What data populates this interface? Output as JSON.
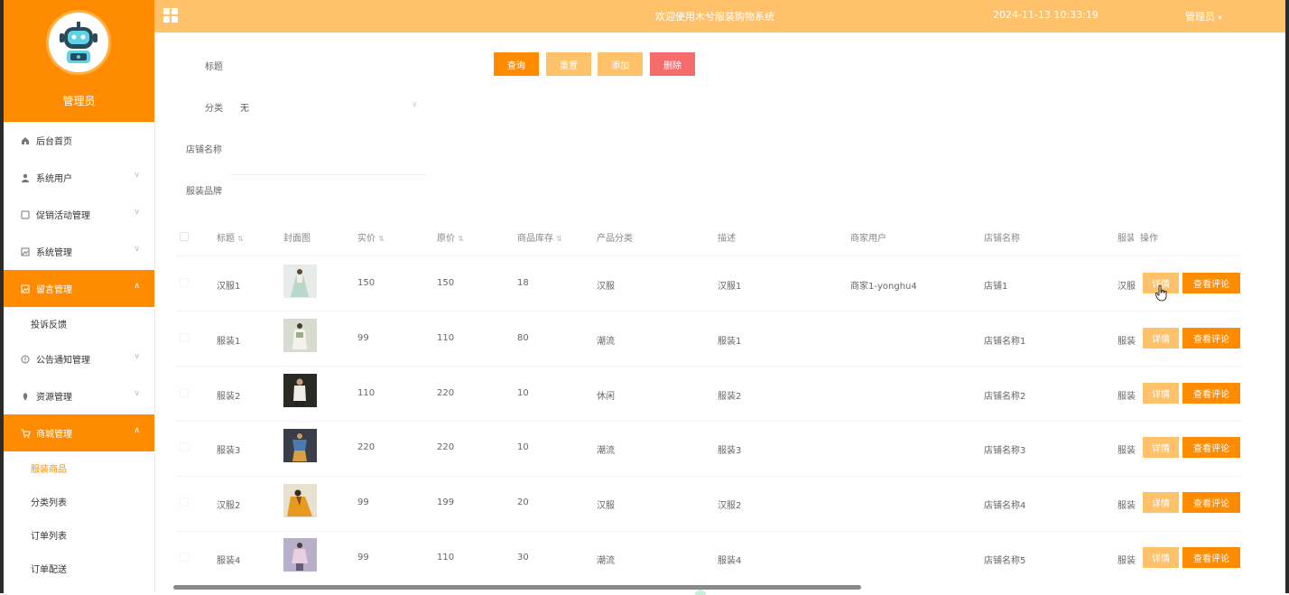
{
  "sidebar": {
    "role": "管理员",
    "menu": [
      {
        "label": "后台首页",
        "icon": "home-icon"
      },
      {
        "label": "系统用户",
        "icon": "user-icon"
      },
      {
        "label": "促销活动管理",
        "icon": "promotion-icon"
      },
      {
        "label": "系统管理",
        "icon": "image-icon"
      },
      {
        "label": "留言管理",
        "icon": "message-icon"
      },
      {
        "label": "投诉反馈"
      },
      {
        "label": "公告通知管理",
        "icon": "info-icon"
      },
      {
        "label": "资源管理",
        "icon": "location-icon"
      },
      {
        "label": "商城管理",
        "icon": "cart-icon"
      },
      {
        "label": "服装商品"
      },
      {
        "label": "分类列表"
      },
      {
        "label": "订单列表"
      },
      {
        "label": "订单配送"
      }
    ]
  },
  "topbar": {
    "title": "欢迎使用木兮服装购物系统",
    "datetime": "2024-11-13 10:33:19",
    "user": "管理员"
  },
  "search": {
    "title_label": "标题",
    "category_label": "分类",
    "category_value": "无",
    "store_label": "店铺名称",
    "brand_label": "服装品牌"
  },
  "actions": {
    "query": "查询",
    "reset": "重置",
    "add": "添加",
    "delete": "删除"
  },
  "table": {
    "columns": {
      "title": "标题",
      "cover": "封面图",
      "price": "实价",
      "original": "原价",
      "stock": "商品库存",
      "category": "产品分类",
      "desc": "描述",
      "merchant": "商家用户",
      "store": "店铺名称",
      "brand": "服装",
      "ops": "操作"
    },
    "detail_label": "详情",
    "comment_label": "查看评论",
    "rows": [
      {
        "title": "汉服1",
        "price": "150",
        "original": "150",
        "stock": "18",
        "category": "汉服",
        "desc": "汉服1",
        "merchant": "商家1-yonghu4",
        "store": "店铺1",
        "brand": "汉服"
      },
      {
        "title": "服装1",
        "price": "99",
        "original": "110",
        "stock": "80",
        "category": "潮流",
        "desc": "服装1",
        "merchant": "",
        "store": "店铺名称1",
        "brand": "服装"
      },
      {
        "title": "服装2",
        "price": "110",
        "original": "220",
        "stock": "10",
        "category": "休闲",
        "desc": "服装2",
        "merchant": "",
        "store": "店铺名称2",
        "brand": "服装"
      },
      {
        "title": "服装3",
        "price": "220",
        "original": "220",
        "stock": "10",
        "category": "潮流",
        "desc": "服装3",
        "merchant": "",
        "store": "店铺名称3",
        "brand": "服装"
      },
      {
        "title": "汉服2",
        "price": "99",
        "original": "199",
        "stock": "20",
        "category": "汉服",
        "desc": "汉服2",
        "merchant": "",
        "store": "店铺名称4",
        "brand": "服装"
      },
      {
        "title": "服装4",
        "price": "99",
        "original": "110",
        "stock": "30",
        "category": "潮流",
        "desc": "服装4",
        "merchant": "",
        "store": "店铺名称5",
        "brand": "服装"
      }
    ]
  },
  "colors": {
    "accent": "#ff8c00",
    "accent_light": "#ffc26b",
    "danger": "#f56c6c"
  }
}
